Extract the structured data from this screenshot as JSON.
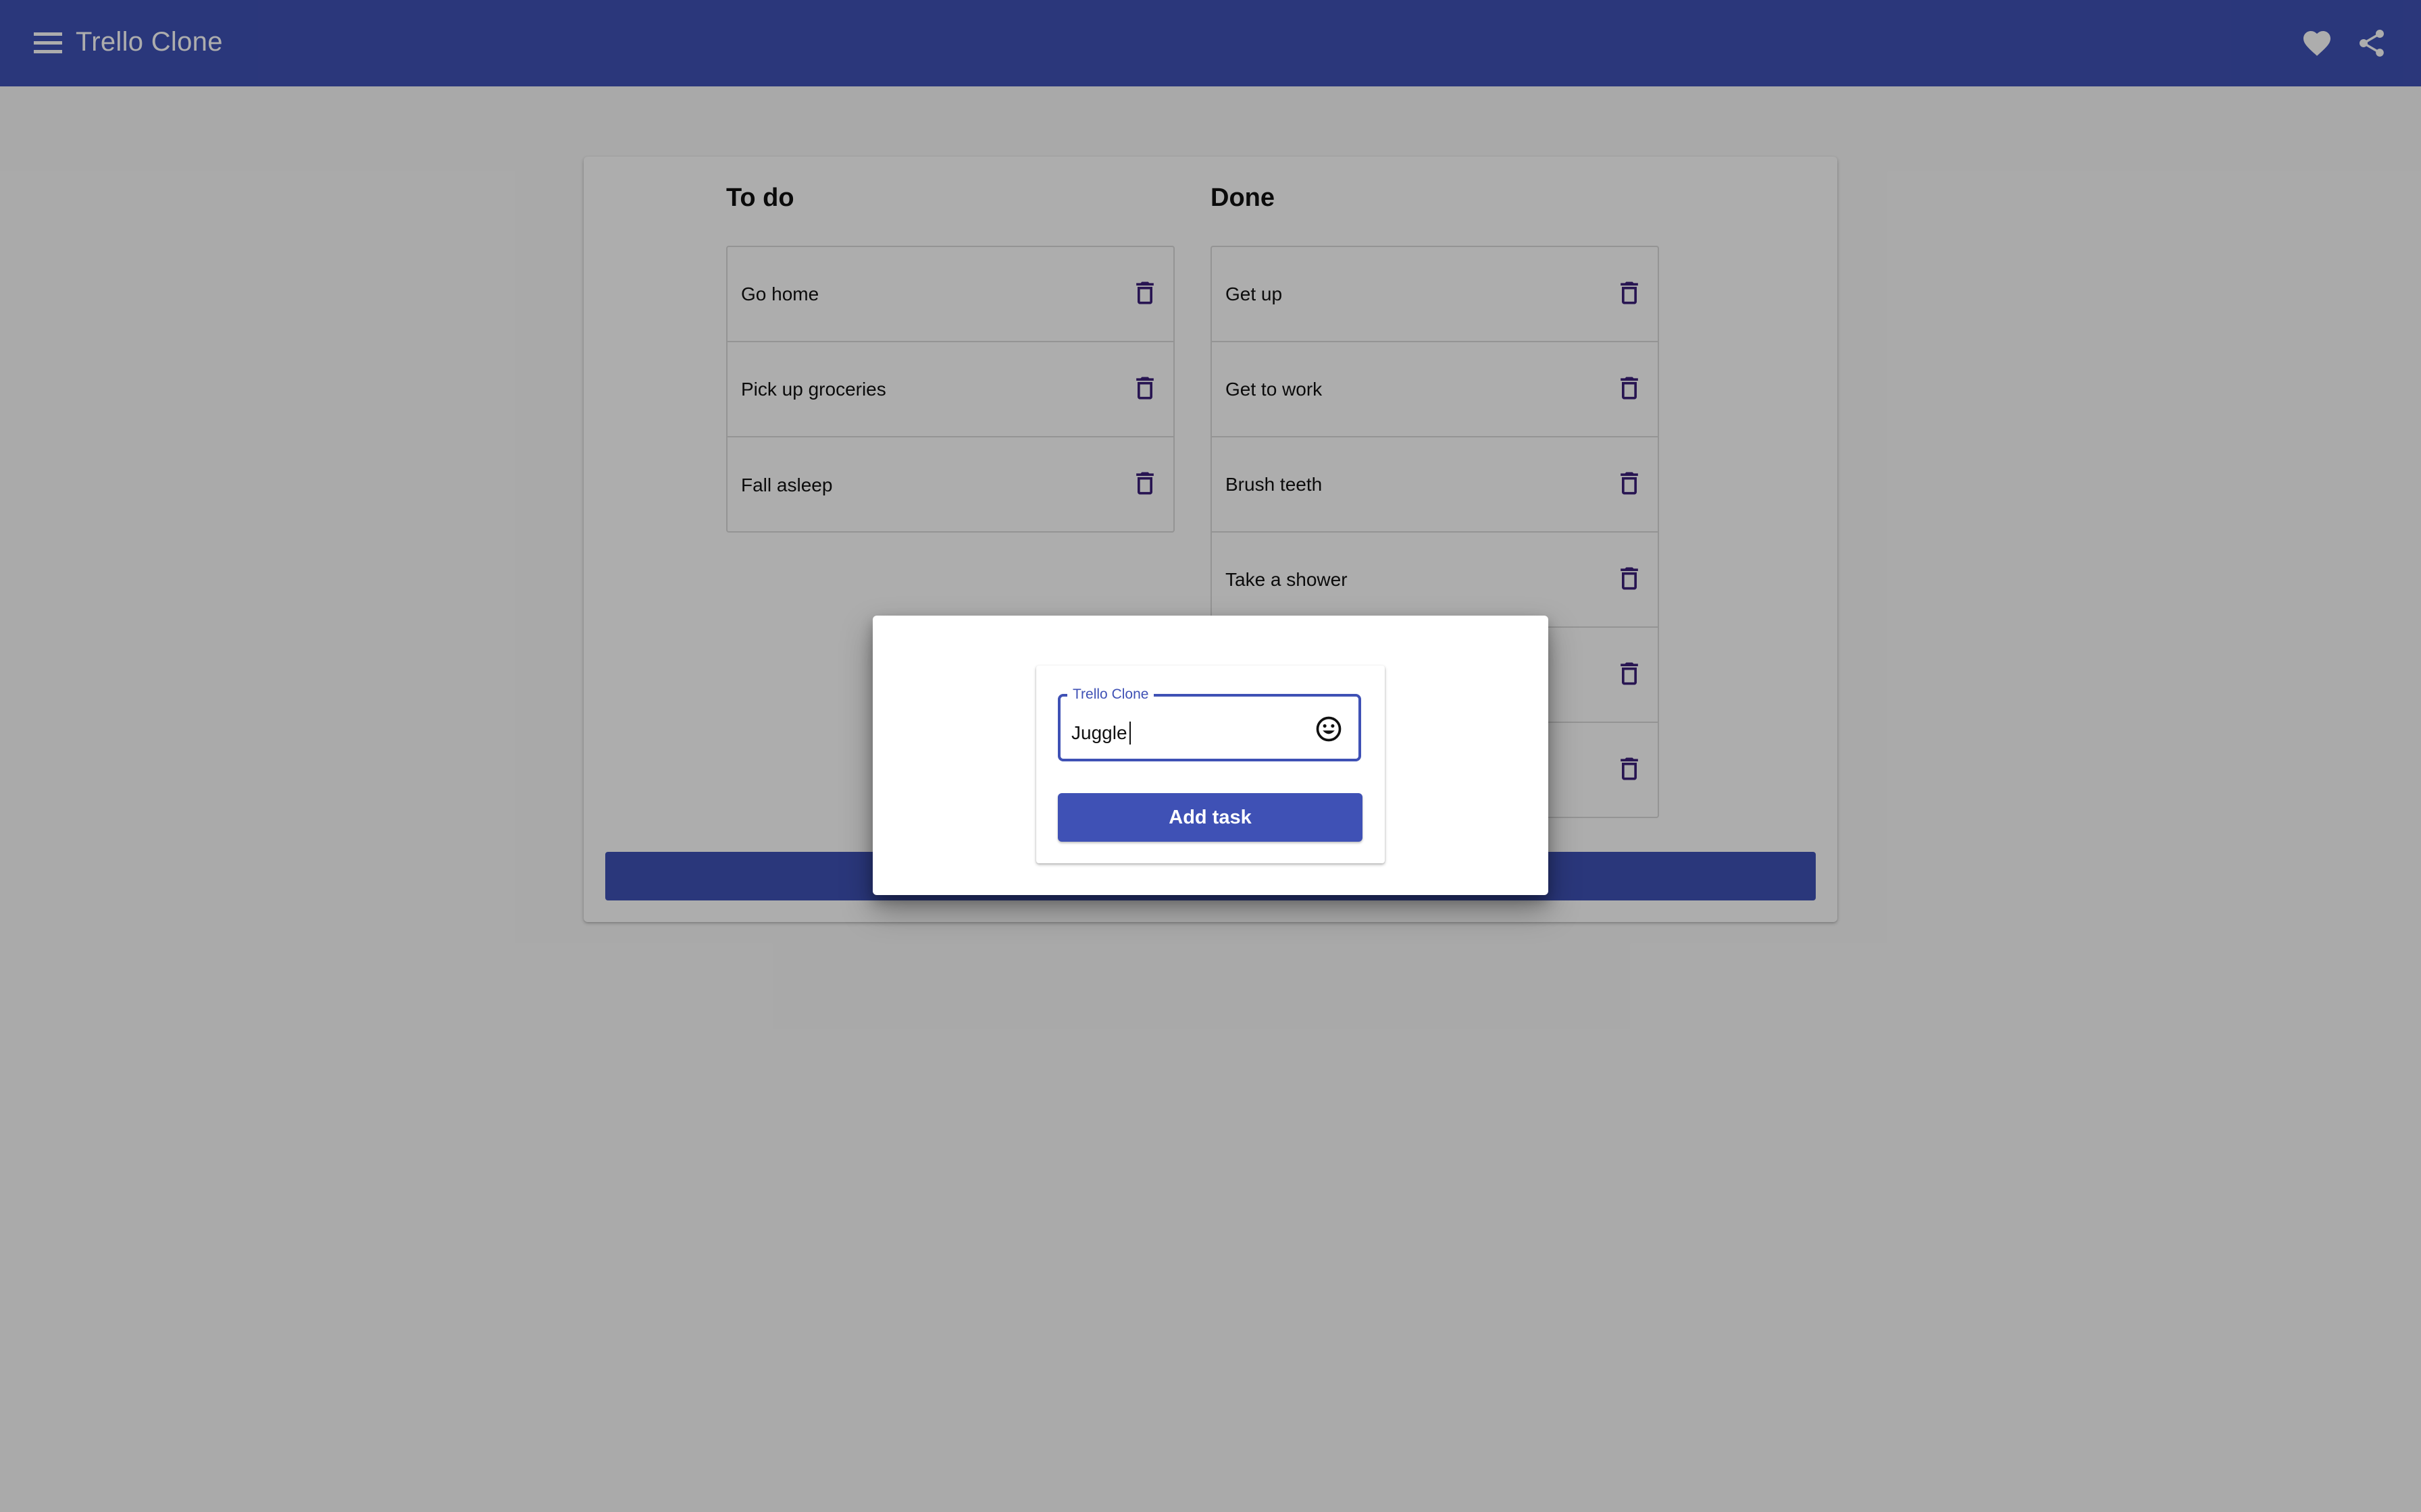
{
  "app": {
    "title": "Trello Clone"
  },
  "toolbar": {
    "menu_icon": "menu-icon",
    "right_icons": [
      "heart-icon",
      "share-icon"
    ]
  },
  "board": {
    "columns": [
      {
        "title": "To do",
        "tasks": [
          "Go home",
          "Pick up groceries",
          "Fall asleep"
        ]
      },
      {
        "title": "Done",
        "tasks": [
          "Get up",
          "Get to work",
          "Brush teeth",
          "Take a shower",
          "",
          ""
        ]
      }
    ],
    "task_action_icon": "trash-icon"
  },
  "dialog": {
    "field_label": "Trello Clone",
    "field_value": "Juggle",
    "emoji_icon": "emoji-icon",
    "submit_label": "Add task"
  },
  "colors": {
    "primary": "#3f51b5",
    "icon": "#3b1f7a",
    "backdrop": "rgba(0,0,0,0.32)"
  }
}
